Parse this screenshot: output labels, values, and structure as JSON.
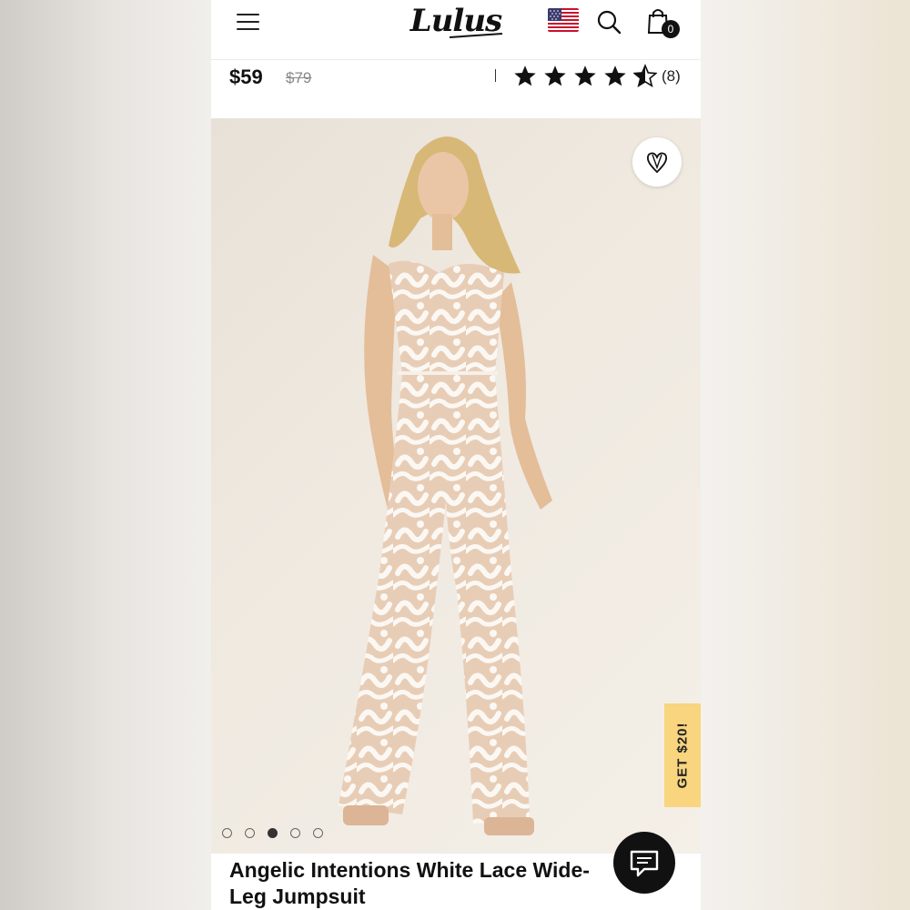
{
  "header": {
    "logo_text": "Lulus",
    "menu_icon": "hamburger-menu-icon",
    "flag_icon": "us-flag-icon",
    "search_icon": "search-icon",
    "bag_icon": "shopping-bag-icon",
    "bag_count": "0"
  },
  "product": {
    "price_now": "$59",
    "price_was": "$79",
    "rating": 4.5,
    "rating_max": 5,
    "review_count": "(8)",
    "title": "Angelic Intentions White Lace Wide-Leg Jumpsuit"
  },
  "gallery": {
    "image_count": 5,
    "active_index": 2,
    "wishlist_icon": "heart-icon"
  },
  "promo": {
    "label": "GET $20!"
  },
  "chat": {
    "icon": "chat-bubble-icon"
  },
  "colors": {
    "accent": "#111111",
    "promo_bg": "#f8d57e"
  }
}
